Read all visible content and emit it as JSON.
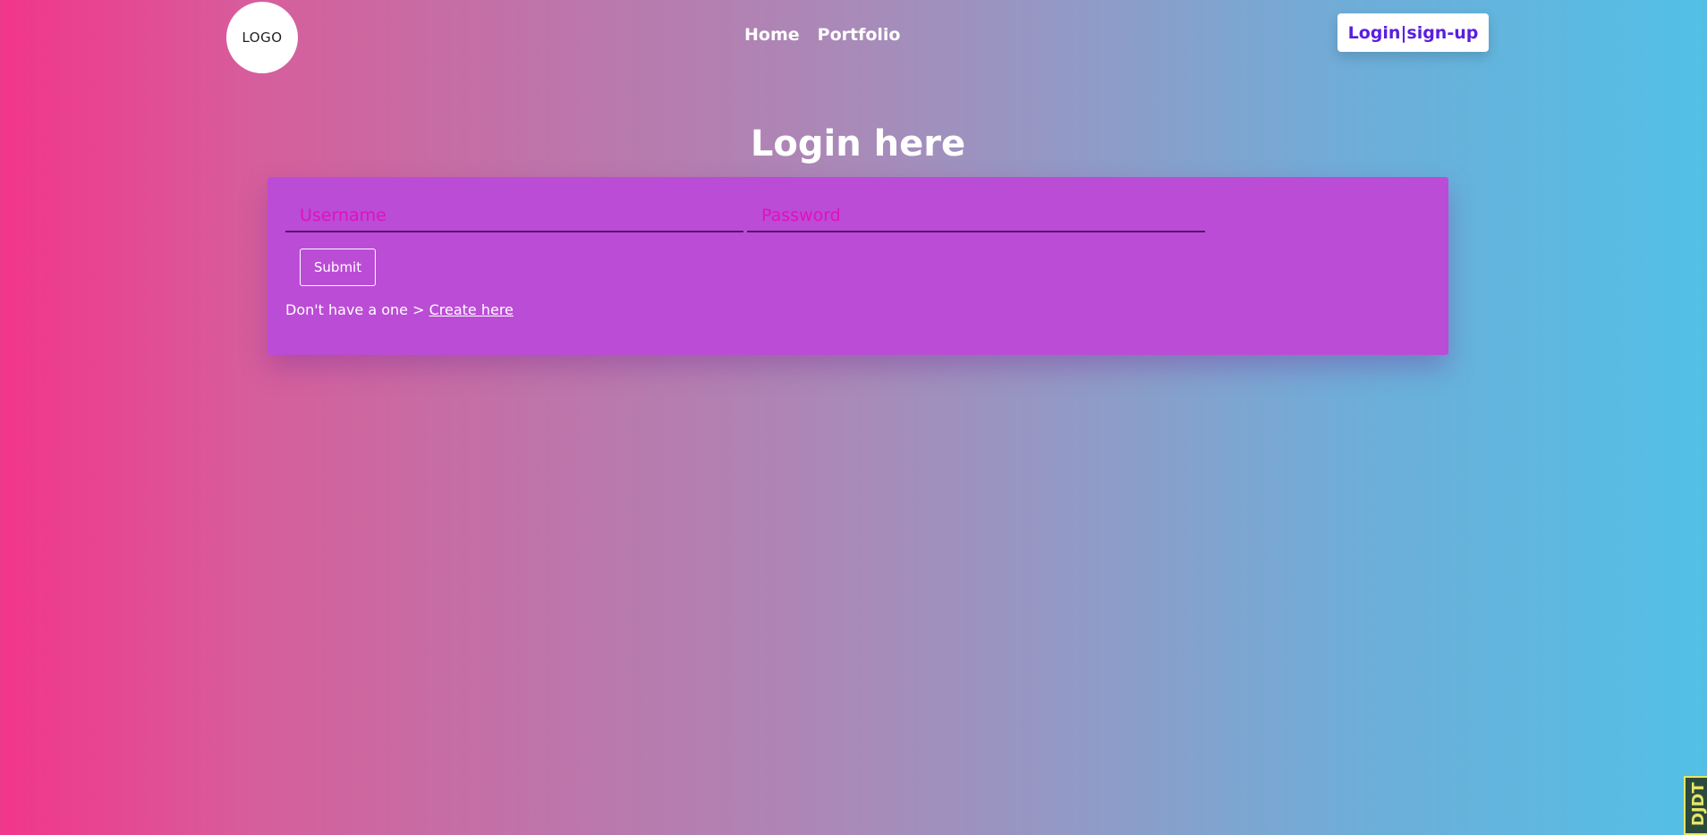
{
  "header": {
    "logo_text": "LOGO",
    "nav_items": [
      "Home",
      "Portfolio"
    ],
    "login_button": "Login|sign-up"
  },
  "main": {
    "title": "Login here",
    "form": {
      "username_placeholder": "Username",
      "password_placeholder": "Password",
      "submit_label": "Submit",
      "signup_prompt": "Don't have a one > ",
      "signup_link": "Create here"
    }
  },
  "corner_widget": {
    "text": "DJDT"
  },
  "colors": {
    "gradient_left": "#f2358b",
    "gradient_right": "#52c0e6",
    "card_bg": "#bb4cd6",
    "placeholder": "#e010c0",
    "login_button_text": "#5a1ee0"
  }
}
